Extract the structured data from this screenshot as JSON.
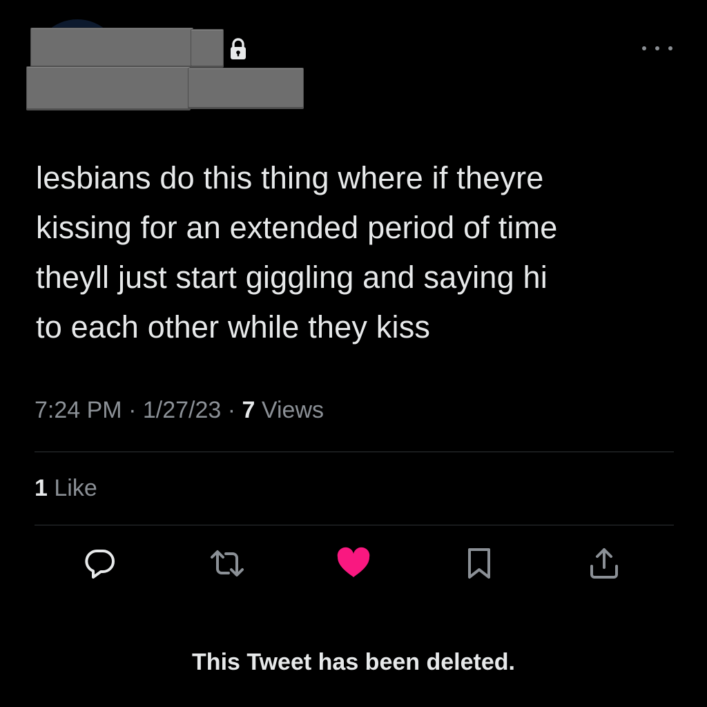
{
  "header": {
    "author_name": "",
    "author_handle": "",
    "lock_icon": "lock-icon",
    "more_icon": "more-icon"
  },
  "tweet": {
    "text": "lesbians do this thing where if theyre\nkissing for an extended period of time\ntheyll just start giggling and saying hi\nto each other while they kiss",
    "time": "7:24 PM",
    "separator": "·",
    "date": "1/27/23",
    "views_count": "7",
    "views_label": "Views",
    "likes_count": "1",
    "likes_label": "Like"
  },
  "actions": {
    "reply_icon": "reply-icon",
    "retweet_icon": "retweet-icon",
    "like_icon": "heart-icon",
    "bookmark_icon": "bookmark-icon",
    "share_icon": "share-icon",
    "like_color": "#f91880",
    "icon_color": "#8b9096"
  },
  "status": {
    "deleted_message": "This Tweet has been deleted."
  }
}
